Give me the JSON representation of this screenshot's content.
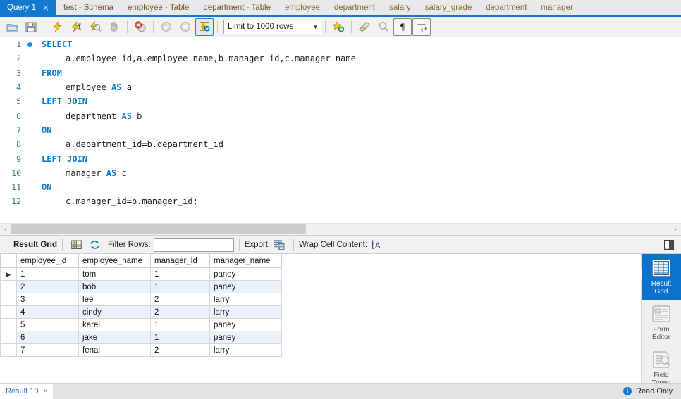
{
  "tabs": [
    {
      "label": "Query 1",
      "active": true,
      "close": "×"
    },
    {
      "label": "test - Schema",
      "active": false
    },
    {
      "label": "employee - Table",
      "active": false
    },
    {
      "label": "department - Table",
      "active": false
    },
    {
      "label": "employee",
      "active": false
    },
    {
      "label": "department",
      "active": false
    },
    {
      "label": "salary",
      "active": false
    },
    {
      "label": "salary_grade",
      "active": false
    },
    {
      "label": "department",
      "active": false
    },
    {
      "label": "manager",
      "active": false
    }
  ],
  "toolbar": {
    "icons": [
      "open-script-icon",
      "save-script-icon",
      "execute-statement-icon",
      "execute-current-statement-icon",
      "explain-query-icon",
      "stop-query-icon",
      "toggle-stop-on-error-icon",
      "commit-icon",
      "rollback-icon",
      "toggle-autocommit-icon"
    ],
    "limit_label": "Limit to 1000 rows",
    "limit_arrow": "▼",
    "right_icons": [
      "add-snippet-icon",
      "beautify-query-icon",
      "find-icon",
      "show-invisible-chars-icon",
      "wrap-lines-icon"
    ]
  },
  "editor": {
    "marker_line": 1,
    "lines": [
      {
        "num": "1",
        "tokens": [
          {
            "t": "SELECT",
            "kw": true
          }
        ],
        "indent": 0
      },
      {
        "num": "2",
        "tokens": [
          {
            "t": "a.employee_id,a.employee_name,b.manager_id,c.manager_name",
            "kw": false
          }
        ],
        "indent": 1
      },
      {
        "num": "3",
        "tokens": [
          {
            "t": "FROM",
            "kw": true
          }
        ],
        "indent": 0
      },
      {
        "num": "4",
        "tokens": [
          {
            "t": "employee ",
            "kw": false
          },
          {
            "t": "AS",
            "kw": true
          },
          {
            "t": " a",
            "kw": false
          }
        ],
        "indent": 1
      },
      {
        "num": "5",
        "tokens": [
          {
            "t": "LEFT JOIN",
            "kw": true
          }
        ],
        "indent": 0
      },
      {
        "num": "6",
        "tokens": [
          {
            "t": "department ",
            "kw": false
          },
          {
            "t": "AS",
            "kw": true
          },
          {
            "t": " b",
            "kw": false
          }
        ],
        "indent": 1
      },
      {
        "num": "7",
        "tokens": [
          {
            "t": "ON",
            "kw": true
          }
        ],
        "indent": 0
      },
      {
        "num": "8",
        "tokens": [
          {
            "t": "a.department_id=b.department_id",
            "kw": false
          }
        ],
        "indent": 1
      },
      {
        "num": "9",
        "tokens": [
          {
            "t": "LEFT JOIN",
            "kw": true
          }
        ],
        "indent": 0
      },
      {
        "num": "10",
        "tokens": [
          {
            "t": "manager ",
            "kw": false
          },
          {
            "t": "AS",
            "kw": true
          },
          {
            "t": " c",
            "kw": false
          }
        ],
        "indent": 1
      },
      {
        "num": "11",
        "tokens": [
          {
            "t": "ON",
            "kw": true
          }
        ],
        "indent": 0
      },
      {
        "num": "12",
        "tokens": [
          {
            "t": "c.manager_id=b.manager_id;",
            "kw": false
          }
        ],
        "indent": 1
      }
    ]
  },
  "scrollbar": {
    "left_arrow": "‹",
    "right_arrow": "›"
  },
  "result_toolbar": {
    "title": "Result Grid",
    "filter_label": "Filter Rows:",
    "filter_value": "",
    "filter_placeholder": "",
    "export_label": "Export:",
    "wrap_label": "Wrap Cell Content:",
    "wrap_icon_glyph": "ᴀ"
  },
  "grid": {
    "columns": [
      "employee_id",
      "employee_name",
      "manager_id",
      "manager_name"
    ],
    "current_row": 1,
    "rows": [
      [
        "1",
        "tom",
        "1",
        "paney"
      ],
      [
        "2",
        "bob",
        "1",
        "paney"
      ],
      [
        "3",
        "lee",
        "2",
        "larry"
      ],
      [
        "4",
        "cindy",
        "2",
        "larry"
      ],
      [
        "5",
        "karel",
        "1",
        "paney"
      ],
      [
        "6",
        "jake",
        "1",
        "paney"
      ],
      [
        "7",
        "fenal",
        "2",
        "larry"
      ]
    ]
  },
  "side_panel": {
    "items": [
      {
        "label_1": "Result",
        "label_2": "Grid",
        "active": true,
        "icon": "grid-icon"
      },
      {
        "label_1": "Form",
        "label_2": "Editor",
        "active": false,
        "icon": "form-icon"
      },
      {
        "label_1": "Field",
        "label_2": "Types",
        "active": false,
        "icon": "field-types-icon"
      }
    ]
  },
  "statusbar": {
    "result_tab": "Result 10",
    "result_close": "×",
    "info_glyph": "i",
    "readonly_label": "Read Only"
  },
  "colors": {
    "accent_blue": "#1279d0",
    "keyword_blue": "#0a7ac8",
    "alt_row": "#eaf1fb",
    "toolbar_bg": "#f1f1f1"
  }
}
